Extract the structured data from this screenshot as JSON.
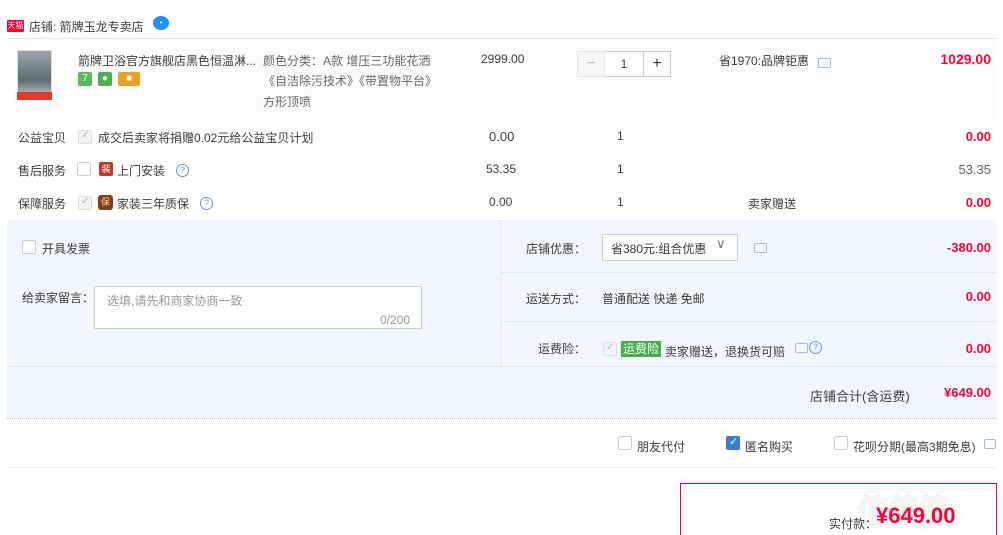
{
  "shop": {
    "badge": "天猫",
    "name": "店铺: 箭牌玉龙专卖店",
    "chat": "•"
  },
  "product": {
    "title": "箭牌卫浴官方旗舰店黑色恒温淋...",
    "props": [
      "颜色分类：A款 增压三功能花洒",
      "《自洁除污技术》《带置物平台》",
      "方形顶喷"
    ],
    "unit_price": "2999.00",
    "qty_minus": "−",
    "qty": "1",
    "qty_plus": "+",
    "discount": "省1970:品牌钜惠",
    "total": "1029.00",
    "icons": [
      "7",
      "●",
      "■"
    ]
  },
  "services": [
    {
      "label": "公益宝贝",
      "desc": "成交后卖家将捐赠0.02元给公益宝贝计划",
      "price": "0.00",
      "qty": "1",
      "extra": "",
      "total": "0.00"
    },
    {
      "label": "售后服务",
      "desc": "上门安装",
      "price": "53.35",
      "qty": "1",
      "extra": "",
      "total": "53.35",
      "badge": "装"
    },
    {
      "label": "保障服务",
      "desc": "家装三年质保",
      "price": "0.00",
      "qty": "1",
      "extra": "卖家赠送",
      "total": "0.00",
      "badge": "保"
    }
  ],
  "invoice": {
    "label": "开具发票"
  },
  "note": {
    "label": "给卖家留言：",
    "placeholder": "选填,请先和商家协商一致",
    "count": "0/200"
  },
  "shop_discount": {
    "label": "店铺优惠：",
    "selected": "省380元:组合优惠",
    "arrow": "∨",
    "value": "-380.00"
  },
  "shipping": {
    "label": "运送方式：",
    "value": "普通配送 快递 免邮",
    "fee": "0.00"
  },
  "insurance": {
    "label": "运费险：",
    "tag": "运费险",
    "desc": "卖家赠送，退换货可赔",
    "fee": "0.00",
    "help": "?"
  },
  "subtotal": {
    "label": "店铺合计(含运费)",
    "value": "¥649.00"
  },
  "options": {
    "friend_pay": "朋友代付",
    "anonymous": "匿名购买",
    "huabei": "花呗分期(最高3期免息)"
  },
  "pay": {
    "label": "实付款：",
    "value": "¥649.00",
    "watermark": "值值值"
  },
  "colors": {
    "accent_red": "#ff0036",
    "panel_bg": "#f2f7ff",
    "check_blue": "#3a7bd5",
    "tag_green": "#46b04a"
  }
}
